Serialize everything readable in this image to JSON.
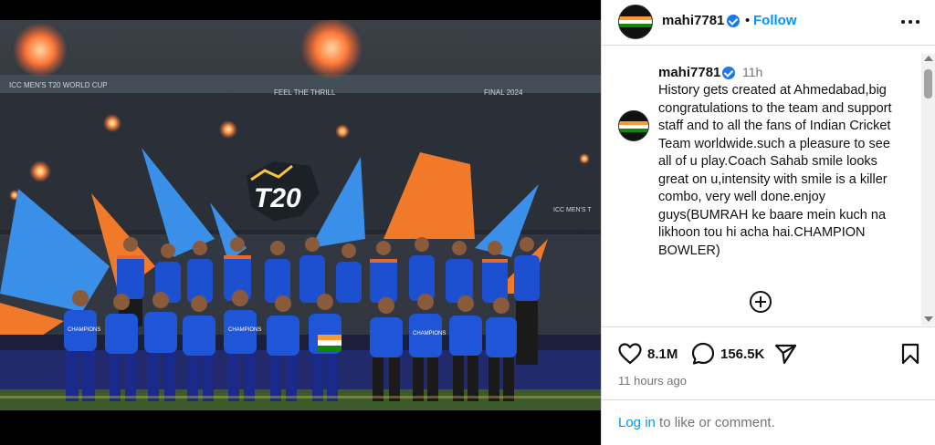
{
  "post": {
    "username": "mahi7781",
    "follow_label": "Follow",
    "separator": "•",
    "caption_time": "11h",
    "caption_text": "History gets created at Ahmedabad,big congratulations to the team and support staff and to all the fans of Indian Cricket Team worldwide.such a pleasure to see all of u play.Coach Sahab smile looks great on u,intensity with smile is a killer combo, very well done.enjoy guys(BUMRAH ke baare mein kuch na likhoon tou hi acha hai.CHAMPION BOWLER)",
    "likes": "8.1M",
    "comments": "156.5K",
    "timestamp": "11 hours ago"
  },
  "footer": {
    "login_link": "Log in",
    "login_rest": " to like or comment."
  },
  "photo": {
    "description_icon": "team-celebration-photo",
    "stadium_texts": [
      "ICC MEN'S T20 WORLD CUP",
      "FEEL THE THRILL",
      "FINAL 2024",
      "ICC MEN'S T"
    ],
    "logo_text": "T20",
    "jersey_text": "CHAMPIONS"
  },
  "colors": {
    "accent": "#0095f6",
    "verified": "#1877f2",
    "jersey": "#1d4fd1",
    "stage_orange": "#f07a2a",
    "stage_blue": "#3a8fe8"
  },
  "icons": {
    "like": "heart-icon",
    "comment": "comment-icon",
    "share": "share-icon",
    "save": "bookmark-icon",
    "more": "more-icon",
    "add": "add-comment-icon"
  }
}
